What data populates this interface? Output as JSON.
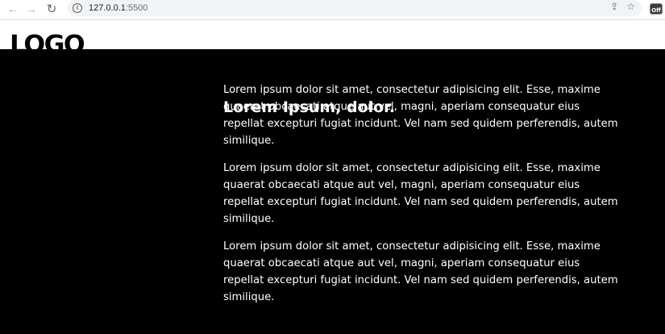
{
  "browser": {
    "url_host": "127.0.0.1",
    "url_port": ":5500",
    "extension_badge": "Off"
  },
  "page": {
    "logo": "LOGO",
    "heading": "Lorem Ipsum, dolor.",
    "paragraphs": [
      "Lorem ipsum dolor sit amet, consectetur adipisicing elit. Esse, maxime quaerat obcaecati atque aut vel, magni, aperiam consequatur eius repellat excepturi fugiat incidunt. Vel nam sed quidem perferendis, autem similique.",
      "Lorem ipsum dolor sit amet, consectetur adipisicing elit. Esse, maxime quaerat obcaecati atque aut vel, magni, aperiam consequatur eius repellat excepturi fugiat incidunt. Vel nam sed quidem perferendis, autem similique.",
      "Lorem ipsum dolor sit amet, consectetur adipisicing elit. Esse, maxime quaerat obcaecati atque aut vel, magni, aperiam consequatur eius repellat excepturi fugiat incidunt. Vel nam sed quidem perferendis, autem similique."
    ],
    "colors": {
      "header_bg": "#ffffff",
      "main_bg": "#000000",
      "text": "#ffffff"
    }
  }
}
